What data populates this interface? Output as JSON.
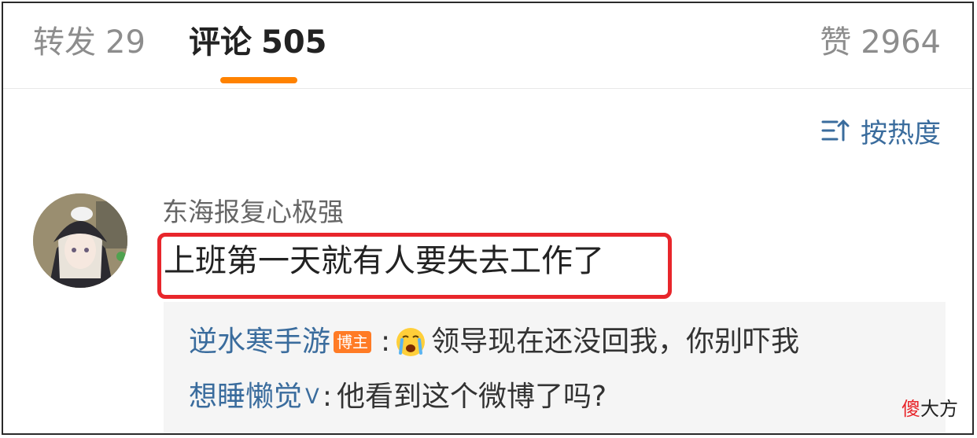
{
  "tabs": {
    "repost": {
      "label": "转发",
      "count": "29"
    },
    "comments": {
      "label": "评论",
      "count": "505"
    },
    "likes": {
      "label": "赞",
      "count": "2964"
    }
  },
  "accent_color": "#ff8200",
  "sort": {
    "label": "按热度",
    "icon": "sort-icon"
  },
  "comment": {
    "username": "东海报复心极强",
    "text": "上班第一天就有人要失去工作了",
    "highlight_color": "#e8262b"
  },
  "replies": [
    {
      "author": "逆水寒手游",
      "badge": "博主",
      "emoji": "crying-emoji",
      "text": "领导现在还没回我，你别吓我"
    },
    {
      "author": "想睡懒觉",
      "badge_icon": "ᐯ",
      "text": "他看到这个微博了吗?"
    }
  ],
  "watermark": {
    "part1": "傻",
    "part2": "大方"
  }
}
